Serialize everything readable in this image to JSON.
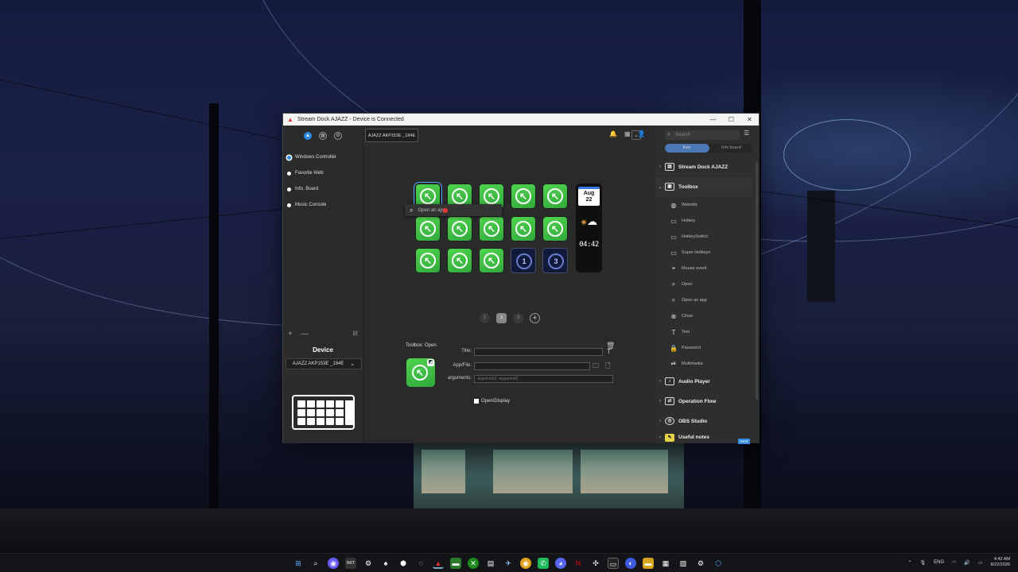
{
  "window": {
    "title": "Stream Dock AJAZZ - Device is Connected",
    "controls": [
      "—",
      "☐",
      "✕"
    ]
  },
  "sidebar": {
    "top_icons": [
      "logo-icon",
      "store-icon",
      "settings-icon"
    ],
    "profiles": [
      {
        "label": "Windows Controller",
        "active": true
      },
      {
        "label": "Favorite Web",
        "active": false
      },
      {
        "label": "Info. Board",
        "active": false
      },
      {
        "label": "Music Console",
        "active": false
      }
    ],
    "add_label": "+",
    "remove_label": "—",
    "device_label": "Device",
    "device_select": "AJAZZ AKP153E _184E"
  },
  "main": {
    "device_tab": "AJAZZ AKP153E _184E",
    "tooltip": "Open an app",
    "tall_key": {
      "month": "Aug",
      "day": "22",
      "clock": "04:42"
    },
    "dark_keys": [
      "1",
      "3"
    ],
    "pages": [
      "1",
      "2",
      "3",
      "+"
    ],
    "current_page": "2",
    "action_title": "Toolbox: Open",
    "form": {
      "title_label": "Title:",
      "app_label": "App/File:",
      "args_label": "arguments:",
      "args_placeholder": "-argument1 -argument2",
      "checkbox_label": "Open/Display"
    }
  },
  "right_panel": {
    "search_placeholder": "Search",
    "tabs": [
      "Key",
      "Info board"
    ],
    "active_tab": "Key",
    "categories": [
      {
        "label": "Stream Dock AJAZZ",
        "open": false
      },
      {
        "label": "Toolbox",
        "open": true
      },
      {
        "label": "Audio Player",
        "open": false
      },
      {
        "label": "Operation Flow",
        "open": false
      },
      {
        "label": "OBS Studio",
        "open": false
      },
      {
        "label": "Useful notes",
        "open": false
      }
    ],
    "toolbox_items": [
      {
        "label": "Website",
        "icon": "globe-icon"
      },
      {
        "label": "Hotkey",
        "icon": "keyboard-icon"
      },
      {
        "label": "HotkeySwitch",
        "icon": "keyboard-switch-icon"
      },
      {
        "label": "Super Hotkeys",
        "icon": "keyboard-super-icon"
      },
      {
        "label": "Mouse event",
        "icon": "mouse-icon"
      },
      {
        "label": "Open",
        "icon": "search-icon"
      },
      {
        "label": "Open an app",
        "icon": "search-icon"
      },
      {
        "label": "Close",
        "icon": "close-circle-icon"
      },
      {
        "label": "Text",
        "icon": "text-icon"
      },
      {
        "label": "Password",
        "icon": "lock-icon"
      },
      {
        "label": "Multimedia",
        "icon": "play-pause-icon"
      }
    ],
    "new_badge": "NEW"
  },
  "taskbar": {
    "lang": "ENG",
    "time": "4:42 AM",
    "date": "8/22/2026"
  }
}
